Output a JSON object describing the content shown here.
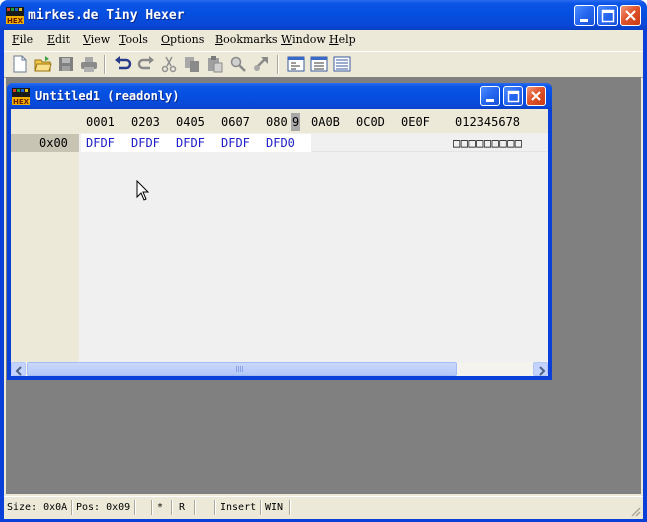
{
  "app": {
    "title": "mirkes.de Tiny Hexer",
    "icon": "hex-app-icon",
    "colors": {
      "titlebar": "#0550e2",
      "mdi_background": "#808080",
      "hex_text": "#2020c8"
    }
  },
  "menu": {
    "items": [
      {
        "label": "File",
        "mnemonic": "F",
        "rest": "ile"
      },
      {
        "label": "Edit",
        "mnemonic": "E",
        "rest": "dit"
      },
      {
        "label": "View",
        "mnemonic": "V",
        "rest": "iew"
      },
      {
        "label": "Tools",
        "mnemonic": "T",
        "rest": "ools"
      },
      {
        "label": "Options",
        "mnemonic": "O",
        "rest": "ptions"
      },
      {
        "label": "Bookmarks",
        "mnemonic": "B",
        "rest": "ookmarks"
      },
      {
        "label": "Window",
        "mnemonic": "W",
        "rest": "indow"
      },
      {
        "label": "Help",
        "mnemonic": "H",
        "rest": "elp"
      }
    ]
  },
  "toolbar": {
    "buttons": [
      "new-file-icon",
      "open-file-icon",
      "save-icon",
      "print-icon",
      "undo-icon",
      "redo-icon",
      "cut-icon",
      "copy-icon",
      "paste-icon",
      "find-icon",
      "replace-icon",
      "view-hex-icon",
      "view-text-icon",
      "view-list-icon"
    ]
  },
  "document": {
    "title": "Untitled1 (readonly)",
    "column_headers": [
      "0001",
      "0203",
      "0405",
      "0607",
      "080",
      "9",
      "0A0B",
      "0C0D",
      "0E0F",
      "012345678"
    ],
    "rows": [
      {
        "address": "0x00",
        "hex": [
          "DFDF",
          "DFDF",
          "DFDF",
          "DFDF",
          "DFD0"
        ],
        "ascii": "□□□□□□□□□"
      }
    ]
  },
  "status": {
    "size": "Size: 0x0A",
    "pos": "Pos: 0x09",
    "modified": "*",
    "mode_r": "R",
    "insert": "Insert",
    "charset": "WIN"
  }
}
